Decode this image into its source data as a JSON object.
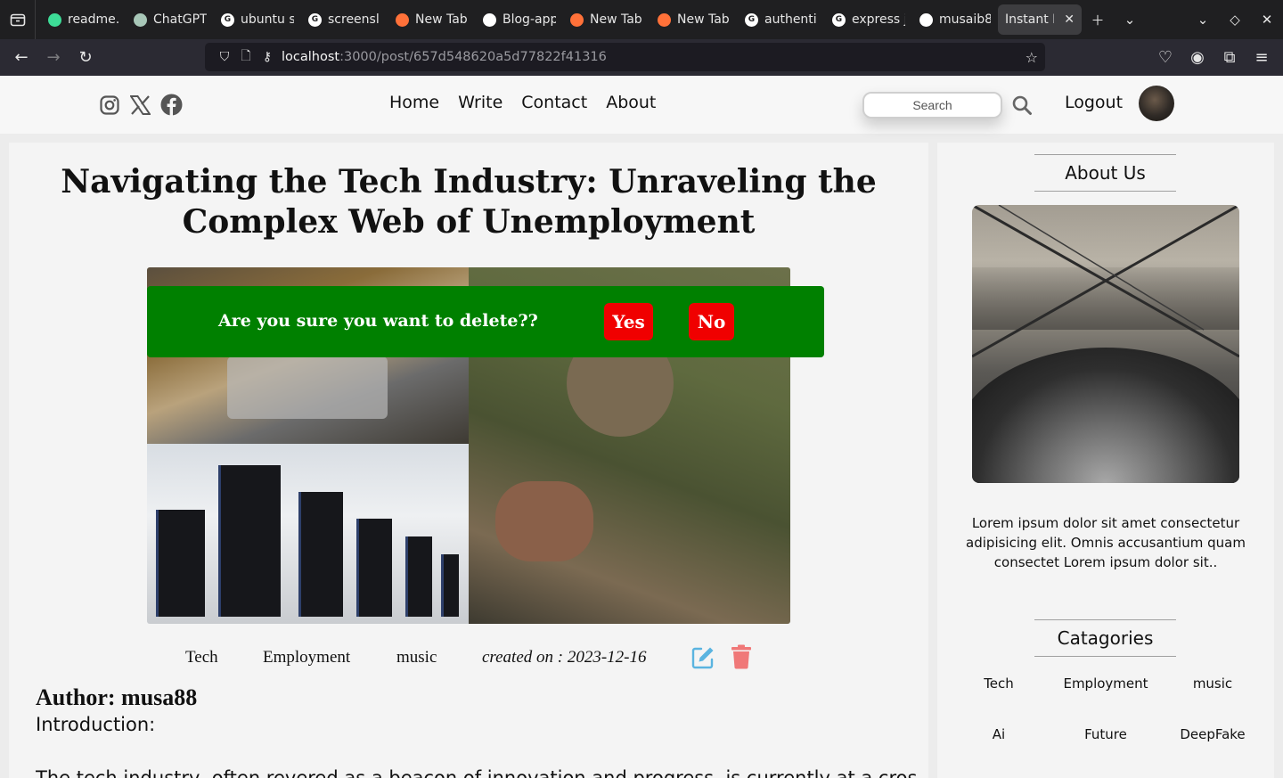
{
  "browser": {
    "tabs": [
      {
        "label": "readme.",
        "favicon_color": "#3ddc97"
      },
      {
        "label": "ChatGPT",
        "favicon_color": "#a8c7b8"
      },
      {
        "label": "ubuntu s",
        "favicon_color": "#ffffff"
      },
      {
        "label": "screensl",
        "favicon_color": "#ffffff"
      },
      {
        "label": "New Tab",
        "favicon_color": "#ff7139"
      },
      {
        "label": "Blog-app",
        "favicon_color": "#ffffff"
      },
      {
        "label": "New Tab",
        "favicon_color": "#ff7139"
      },
      {
        "label": "New Tab",
        "favicon_color": "#ff7139"
      },
      {
        "label": "authenti",
        "favicon_color": "#ffffff"
      },
      {
        "label": "express j",
        "favicon_color": "#ffffff"
      },
      {
        "label": "musaib8",
        "favicon_color": "#ffffff"
      },
      {
        "label": "Instant Bl",
        "favicon_color": "#3d3d40",
        "active": true
      }
    ],
    "url_host": "localhost",
    "url_path": ":3000/post/657d548620a5d77822f41316"
  },
  "header": {
    "menu": [
      "Home",
      "Write",
      "Contact",
      "About"
    ],
    "search_placeholder": "Search",
    "logout_label": "Logout"
  },
  "post": {
    "title": "Navigating the Tech Industry: Unraveling the Complex Web of Unemployment",
    "categories": [
      "Tech",
      "Employment",
      "music"
    ],
    "created_on": "created on : 2023-12-16",
    "author": "Author: musa88",
    "intro_label": "Introduction:",
    "body_first_line": "The tech industry, often revered as a beacon of innovation and progress, is currently at a crossroads"
  },
  "modal": {
    "question": "Are you sure you want to delete??",
    "yes_label": "Yes",
    "no_label": "No",
    "background": "#008000",
    "button_color": "#f00000"
  },
  "sidebar": {
    "about_heading": "About Us",
    "about_text": "Lorem ipsum dolor sit amet consectetur adipisicing elit. Omnis accusantium quam consectet Lorem ipsum dolor sit..",
    "categories_heading": "Catagories",
    "categories": [
      "Tech",
      "Employment",
      "music",
      "Ai",
      "Future",
      "DeepFake"
    ]
  },
  "colors": {
    "edit_icon": "#5ab4e0",
    "trash_icon": "#f07878"
  }
}
